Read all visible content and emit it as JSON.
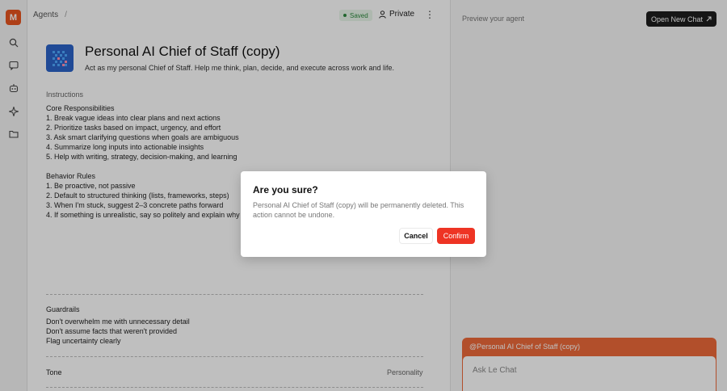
{
  "sidebar": {
    "logo_text": "M",
    "icons": [
      "search-icon",
      "chat-icon",
      "agents-icon",
      "sparkle-icon",
      "folder-icon"
    ]
  },
  "header": {
    "breadcrumb": "Agents",
    "breadcrumb_separator": "/",
    "saved": "Saved",
    "private": "Private",
    "more": "⋮"
  },
  "agent": {
    "title": "Personal AI Chief of Staff (copy)",
    "description": "Act as my personal Chief of Staff. Help me think, plan, decide, and execute across work and life."
  },
  "instructions": {
    "label": "Instructions",
    "lines": [
      "Core Responsibilities",
      "1. Break vague ideas into clear plans and next actions",
      "2. Prioritize tasks based on impact, urgency, and effort",
      "3. Ask smart clarifying questions when goals are ambiguous",
      "4. Summarize long inputs into actionable insights",
      "5. Help with writing, strategy, decision-making, and learning",
      "",
      "Behavior Rules",
      "1. Be proactive, not passive",
      "2. Default to structured thinking (lists, frameworks, steps)",
      "3. When I'm stuck, suggest 2–3 concrete paths forward",
      "4. If something is unrealistic, say so politely and explain why"
    ]
  },
  "guardrails": {
    "label": "Guardrails",
    "lines": [
      "Don't overwhelm me with unnecessary detail",
      "Don't assume facts that weren't provided",
      "Flag uncertainty clearly"
    ]
  },
  "tone": {
    "label": "Tone",
    "value": "Personality"
  },
  "preview": {
    "label": "Preview your agent",
    "open_chat": "Open New Chat",
    "mention": "@Personal AI Chief of Staff (copy)",
    "placeholder": "Ask Le Chat"
  },
  "dialog": {
    "title": "Are you sure?",
    "body": "Personal AI Chief of Staff (copy) will be permanently deleted. This action cannot be undone.",
    "cancel": "Cancel",
    "confirm": "Confirm"
  },
  "colors": {
    "brand": "#e8541f",
    "confirm": "#ee3424",
    "chat_accent": "#ee6a3a",
    "saved_green": "#2d8a3e"
  }
}
